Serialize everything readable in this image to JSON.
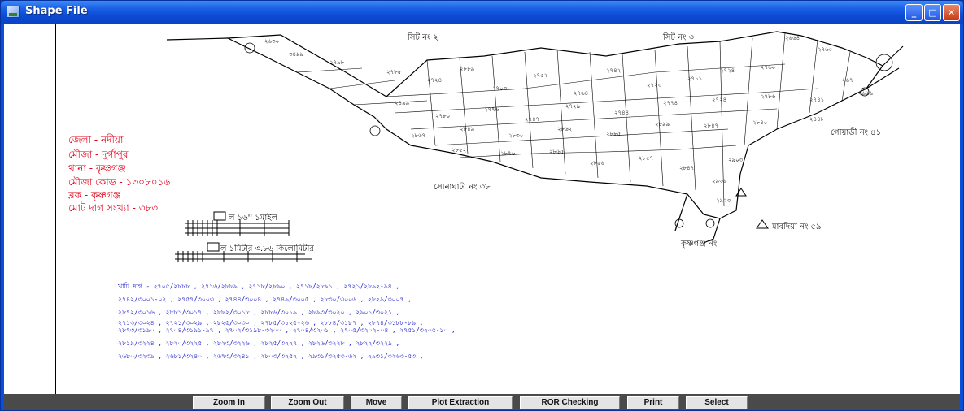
{
  "window": {
    "title": "Shape File",
    "minimize_symbol": "_",
    "maximize_symbol": "□",
    "close_symbol": "✕",
    "title_color": "#0a44c4"
  },
  "legend": {
    "district": "জেলা -   নদীয়া",
    "mouza": "মৌজা -   দুর্গাপুর",
    "thana": "থানা -     কৃষ্ণগঞ্জ",
    "mouza_code": "মৌজা কোড - ১৩০৮০১৬",
    "block": "ব্লক -      কৃষ্ণগঞ্জ",
    "total_plots": "মোট দাগ সংখ্যা - ৩৮৩",
    "color": "#e3001b"
  },
  "map_labels": {
    "sheet_2": "সিট নং ২",
    "sheet_3": "সিট নং ৩",
    "gorachand": "গোয়াডী নং ৪১",
    "sonaghati": "সোনাঘাটা নং ৩৮",
    "madhabdia": "মাবদিয়া নং ৫৯",
    "krishnaganj": "কৃষ্ণগঞ্জ নং"
  },
  "scale": {
    "inch_label": "ল ১৬'' ১মাইল",
    "km_label": "ল ১মিটার ৩.৮৬ কিলোমিটার"
  },
  "plot_list": {
    "color": "#1a1ac8",
    "lines": [
      "খাটি দাগ - ২৭০৫/২৮৮৮ , ২৭১৬/২৮৮৯ , ২৭১৮/২৮৯০ , ২৭১৮/২৮৯১ , ২৭২১/২৮৯২-৯৪ ,",
      "২৭৪২/৩০০১-০২ , ২৭৫৭/৩০০৩ , ২৭৪৪/৩০০৪ , ২৭৪৯/৩০০৫ , ২৮৩০/৩০০৬ , ২৮২৯/৩০০৭ ,",
      "২৮৭২/৩০১৬ , ২৮৮১/৩০১৭ , ২৮৮২/৩০১৮ , ২৮৮৬/৩০১৯ , ২৮৯৩/৩০২০ , ২৯০১/৩০২১ ,",
      "২৭১৩/৩০২৪ , ২৭২১/৩০২৯ , ২৮২৫/৩০৩০ , ২৭৮৫/৩১২৫-২৬ , ২৮৮৪/৩১৮৭ , ২৮৭৪/৩১৮৮-৮৯ ,",
      "২৮৭৩/৩১৯০ , ২৭০৪/৩১৯১-৯৭ , ২৭০২/৩১৯৮-৩২০০ , ২৭০৪/৩২০১ , ২৭০৫/৩২০২-০৪ , ২৭৫১/৩২০৫-১০ ,",
      "২৮১৯/৩২২৪ , ২৮২০/৩২২৫ , ২৮২৩/৩২২৬ , ২৮২৫/৩২২৭ , ২৮২৬/৩২২৮ , ২৮২২/৩২২৯ ,",
      "২৬৮০/৩২৩৯ , ২৬৮১/৩২৪০ , ২৬৭৩/৩২৪১ , ২৮০৩/৩২৫২ , ২৯৩১/৩২৫৩-৬২ , ২৯৩১/৩২৬৩-৫৩ ,"
    ]
  },
  "toolbar": {
    "zoom_in": "Zoom In",
    "zoom_out": "Zoom Out",
    "move": "Move",
    "plot_extraction": "Plot Extraction",
    "ror_checking": "ROR Checking",
    "print": "Print",
    "select": "Select"
  }
}
